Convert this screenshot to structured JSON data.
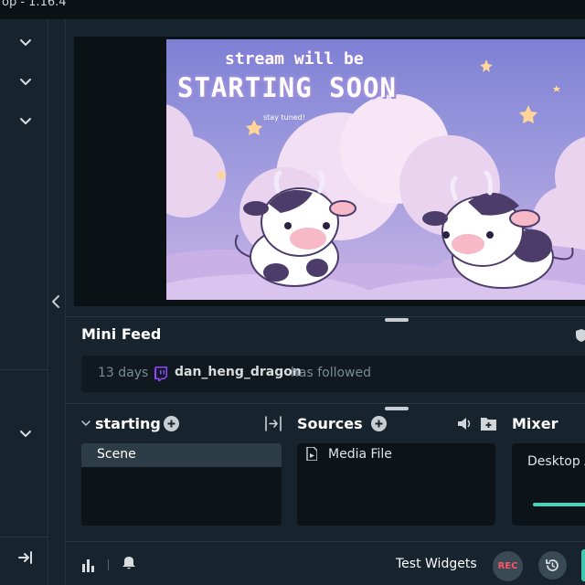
{
  "window": {
    "title": "op - 1.16.4"
  },
  "preview": {
    "line1": "stream will be",
    "line2": "STARTING SOON",
    "line3": "stay tuned!"
  },
  "mini_feed": {
    "title": "Mini Feed",
    "event": {
      "time": "13 days",
      "user": "dan_heng_dragon",
      "action": "has followed"
    }
  },
  "scenes": {
    "collection_name": "starting",
    "items": [
      "Scene"
    ]
  },
  "sources": {
    "title": "Sources",
    "items": [
      "Media File"
    ]
  },
  "mixer": {
    "title": "Mixer",
    "channel_label": "Desktop A"
  },
  "footer": {
    "test_widgets_label": "Test Widgets",
    "rec_label": "REC"
  },
  "icons": {
    "nav": [
      "chevron-down-icon",
      "chevron-down-icon",
      "chevron-down-icon",
      "chevron-down-icon",
      "collapse-to-edge-icon"
    ],
    "scenes": [
      "add-icon",
      "transition-icon"
    ],
    "sources": [
      "add-icon",
      "speaker-icon",
      "add-folder-icon"
    ],
    "footer": [
      "stats-icon",
      "bell-icon",
      "replay-icon"
    ]
  },
  "colors": {
    "background": "#17242d",
    "panel": "#0c1419",
    "accent": "#4fd1b9",
    "twitch": "#9146ff",
    "rec": "#ff5468"
  }
}
